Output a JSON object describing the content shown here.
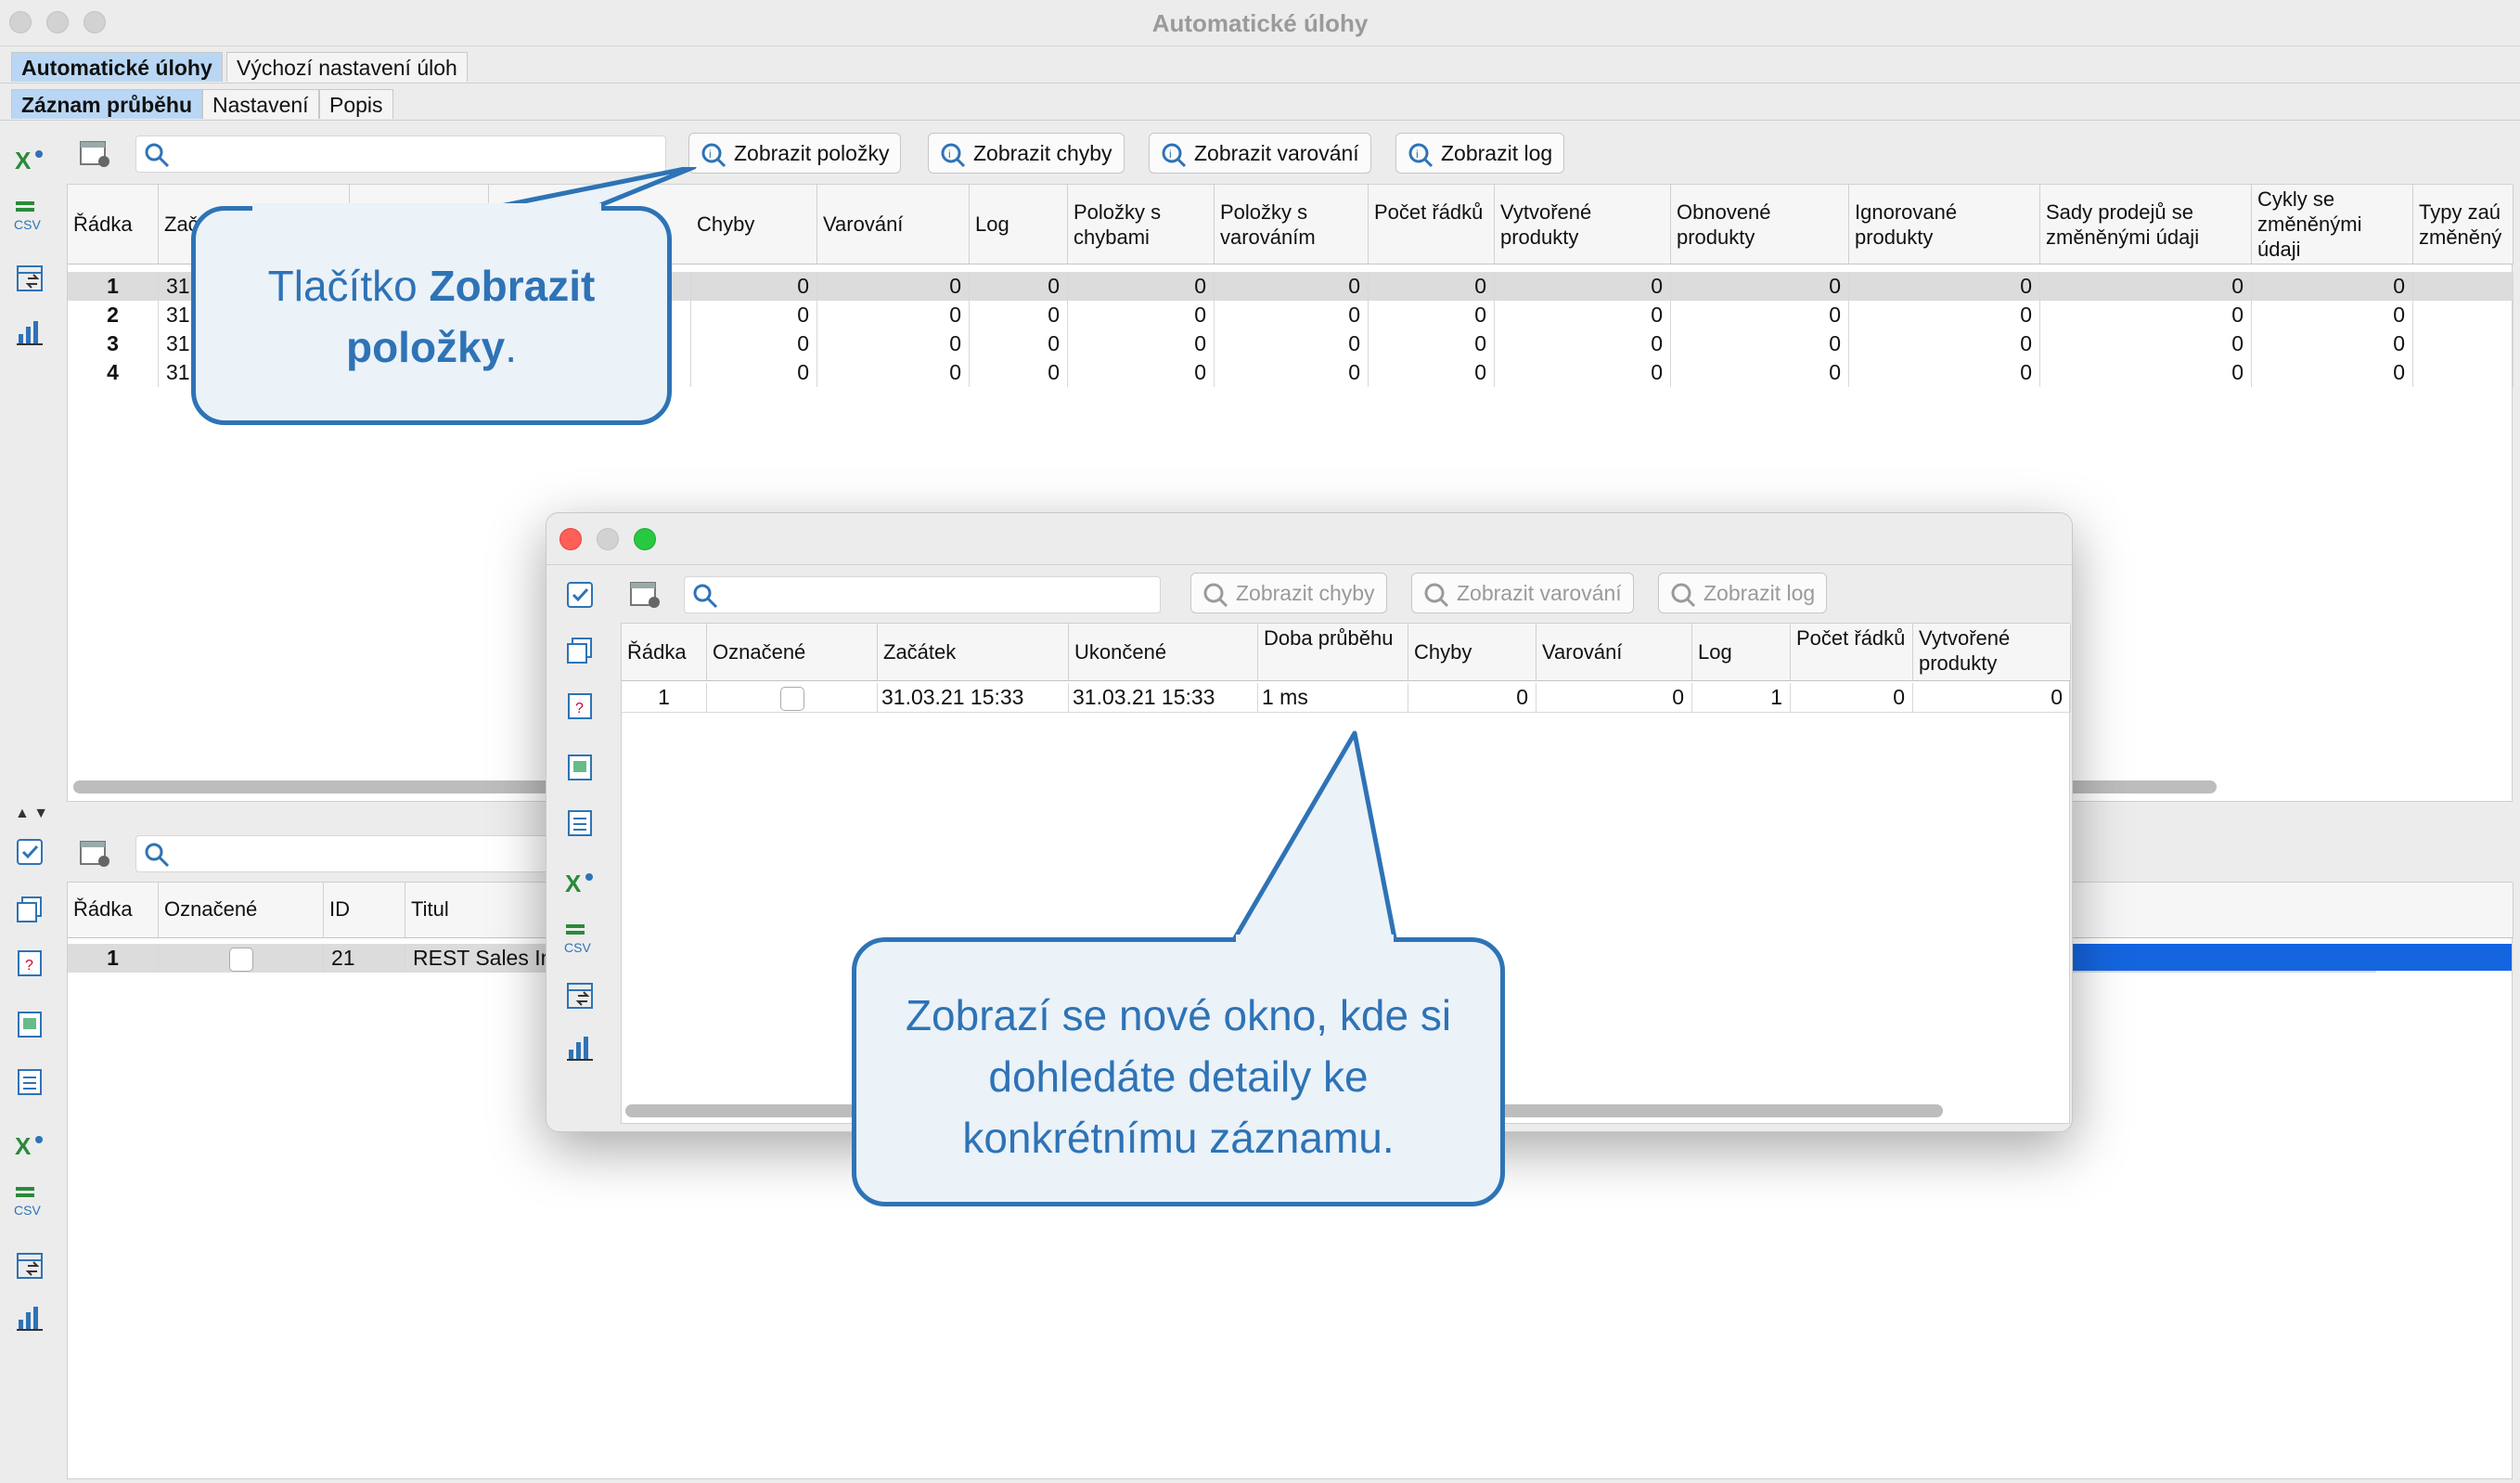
{
  "window": {
    "title": "Automatické úlohy"
  },
  "main_tabs": [
    {
      "label": "Automatické úlohy"
    },
    {
      "label": "Výchozí nastavení úloh"
    }
  ],
  "sub_tabs": [
    {
      "label": "Záznam průběhu"
    },
    {
      "label": "Nastavení"
    },
    {
      "label": "Popis"
    }
  ],
  "toolbar": {
    "search_placeholder": "",
    "show_items": "Zobrazit položky",
    "show_errors": "Zobrazit chyby",
    "show_warnings": "Zobrazit varování",
    "show_log": "Zobrazit log"
  },
  "top_table": {
    "headers": [
      "Řádka",
      "Začátek",
      "",
      "",
      "Chyby",
      "Varování",
      "Log",
      "Položky s chybami",
      "Položky s varováním",
      "Počet řádků",
      "Vytvořené produkty",
      "Obnovené produkty",
      "Ignorované produkty",
      "Sady prodejů se změněnými údaji",
      "Cykly se změněnými údaji",
      "Typy zaú změněný"
    ],
    "rows": [
      {
        "row": "1",
        "start": "31",
        "values": [
          "0",
          "0",
          "0",
          "0",
          "0",
          "0",
          "0",
          "0",
          "0",
          "0",
          "0"
        ]
      },
      {
        "row": "2",
        "start": "31",
        "values": [
          "0",
          "0",
          "0",
          "0",
          "0",
          "0",
          "0",
          "0",
          "0",
          "0",
          "0"
        ]
      },
      {
        "row": "3",
        "start": "31",
        "values": [
          "0",
          "0",
          "0",
          "0",
          "0",
          "0",
          "0",
          "0",
          "0",
          "0",
          "0"
        ]
      },
      {
        "row": "4",
        "start": "31",
        "values": [
          "0",
          "0",
          "0",
          "0",
          "0",
          "0",
          "0",
          "0",
          "0",
          "0",
          "0"
        ]
      }
    ]
  },
  "bottom_table": {
    "headers": [
      "Řádka",
      "Označené",
      "ID",
      "Titul"
    ],
    "rows": [
      {
        "row": "1",
        "id": "21",
        "title": "REST Sales In"
      }
    ]
  },
  "popup": {
    "toolbar": {
      "show_errors": "Zobrazit chyby",
      "show_warnings": "Zobrazit varování",
      "show_log": "Zobrazit log"
    },
    "headers": [
      "Řádka",
      "Označené",
      "Začátek",
      "Ukončené",
      "Doba průběhu",
      "Chyby",
      "Varování",
      "Log",
      "Počet řádků",
      "Vytvořené produkty"
    ],
    "rows": [
      {
        "row": "1",
        "start": "31.03.21 15:33",
        "end": "31.03.21 15:33",
        "duration": "1 ms",
        "errors": "0",
        "warnings": "0",
        "log": "1",
        "rows_count": "0",
        "created": "0"
      }
    ]
  },
  "callouts": {
    "button_pre": "Tlačítko ",
    "button_bold": "Zobrazit položky",
    "button_post": ".",
    "window_text": "Zobrazí se nové okno, kde si dohledáte detaily ke konkrétnímu záznamu."
  },
  "colors": {
    "accent": "#2e73b6",
    "callout_bg": "#ebf2f8",
    "tab_selected": "#b9d7f4",
    "selection_blue": "#1565e0"
  }
}
